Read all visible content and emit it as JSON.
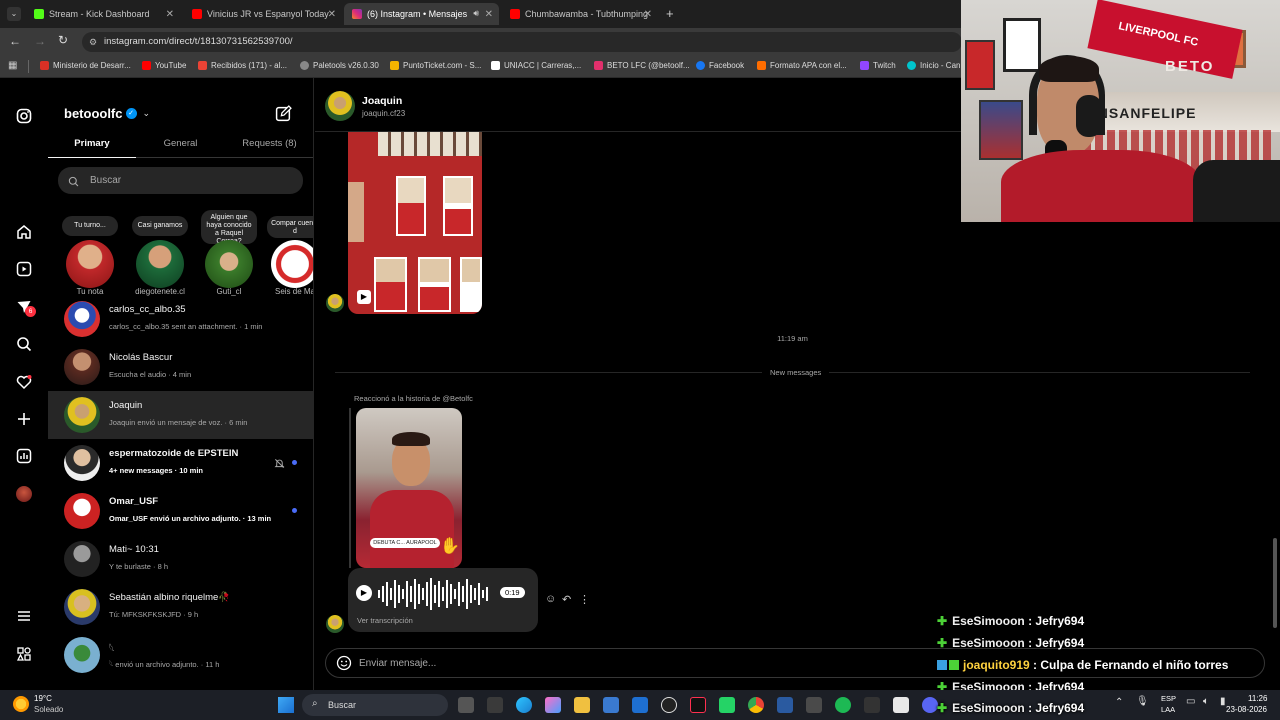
{
  "browser": {
    "tabs": [
      {
        "title": "Stream - Kick Dashboard",
        "color": "#53fc18"
      },
      {
        "title": "Vinicius JR vs Espanyol Today",
        "color": "#ff0000"
      },
      {
        "title": "(6) Instagram • Mensajes",
        "color": "#e1306c"
      },
      {
        "title": "Chumbawamba - Tubthumping",
        "color": "#ff0000"
      }
    ],
    "new_tab": "+",
    "url": "instagram.com/direct/t/18130731562539700/",
    "bookmarks": [
      {
        "label": "Ministerio de Desarr...",
        "color": "#d93025"
      },
      {
        "label": "YouTube",
        "color": "#ff0000"
      },
      {
        "label": "Recibidos (171) - al...",
        "color": "#ea4335"
      },
      {
        "label": "Paletools v26.0.30",
        "color": "#888888"
      },
      {
        "label": "PuntoTicket.com - S...",
        "color": "#f4b400"
      },
      {
        "label": "UNIACC | Carreras,...",
        "color": "#ffffff"
      },
      {
        "label": "BETO LFC (@betoolf...",
        "color": "#e1306c"
      },
      {
        "label": "Facebook",
        "color": "#1877f2"
      },
      {
        "label": "Formato APA con el...",
        "color": "#ff6d00"
      },
      {
        "label": "Twitch",
        "color": "#9146ff"
      },
      {
        "label": "Inicio - Can",
        "color": "#00c4cc"
      }
    ]
  },
  "inbox": {
    "username": "betooolfc",
    "tabs": [
      "Primary",
      "General",
      "Requests (8)"
    ],
    "search_placeholder": "Buscar",
    "notes": [
      {
        "bubble": "Tu turno...",
        "label": "Tu nota"
      },
      {
        "bubble": "Casi ganamos",
        "label": "diegotenete.cl"
      },
      {
        "bubble": "Alguien que haya conocido a Raquel Correa?",
        "label": "Guti_cl"
      },
      {
        "bubble": "Compar cuenta d",
        "label": "Seis de Ma"
      }
    ],
    "conversations": [
      {
        "name": "carlos_cc_albo.35",
        "preview": "carlos_cc_albo.35 sent an attachment. · 1 min",
        "color": "#3a4a6b"
      },
      {
        "name": "Nicolás Bascur",
        "preview": "Escucha el audio · 4 min",
        "color": "#6b3a2a"
      },
      {
        "name": "Joaquin",
        "preview": "Joaquin envió un mensaje de voz. · 6 min",
        "color": "#8a8a1a"
      },
      {
        "name": "espermatozoide de EPSTEIN",
        "preview": "4+ new messages · 10 min",
        "color": "#4a4a4a"
      },
      {
        "name": "Omar_USF",
        "preview": "Omar_USF envió un archivo adjunto. · 13 min",
        "color": "#aa2222"
      },
      {
        "name": "Mati~ 10:31",
        "preview": "Y te burlaste · 8 h",
        "color": "#3a3a3a"
      },
      {
        "name": "Sebastián albino riquelme🥀",
        "preview": "Tú: MFKSKFKSKJFD · 9 h",
        "color": "#5a5a2a"
      },
      {
        "name": "𓆩",
        "preview": "𓆩 envió un archivo adjunto. · 11 h",
        "color": "#2a6a8a"
      }
    ],
    "nav_badge": "6"
  },
  "chat": {
    "contact_name": "Joaquin",
    "contact_handle": "joaquin.cf23",
    "timestamp": "11:19 am",
    "divider": "New messages",
    "reaction_label": "Reaccionó a la historia de @Betolfc",
    "story_caption": "DEBUTA C... AURAPOOL",
    "audio_duration": "0:19",
    "transcript_link": "Ver transcripción",
    "composer_placeholder": "Enviar mensaje..."
  },
  "webcam": {
    "flag_text": "LIVERPOOL FC",
    "wall_text": "BETO",
    "shelf_text": "IONSANFELIPE"
  },
  "stream_chat": [
    {
      "user": "EseSimooon",
      "message": ": Jefry694",
      "highlight": false
    },
    {
      "user": "EseSimooon",
      "message": ": Jefry694",
      "highlight": false
    },
    {
      "user": "joaquito919",
      "message": ": Culpa de Fernando el niño torres",
      "highlight": true
    },
    {
      "user": "EseSimooon",
      "message": ": Jefry694",
      "highlight": false
    },
    {
      "user": "EseSimooon",
      "message": ": Jefry694",
      "highlight": false
    }
  ],
  "taskbar": {
    "weather_temp": "19°C",
    "weather_desc": "Soleado",
    "search_label": "Buscar",
    "lang_top": "ESP",
    "lang_bottom": "LAA",
    "time": "11:26",
    "date": "23-08-2026"
  }
}
